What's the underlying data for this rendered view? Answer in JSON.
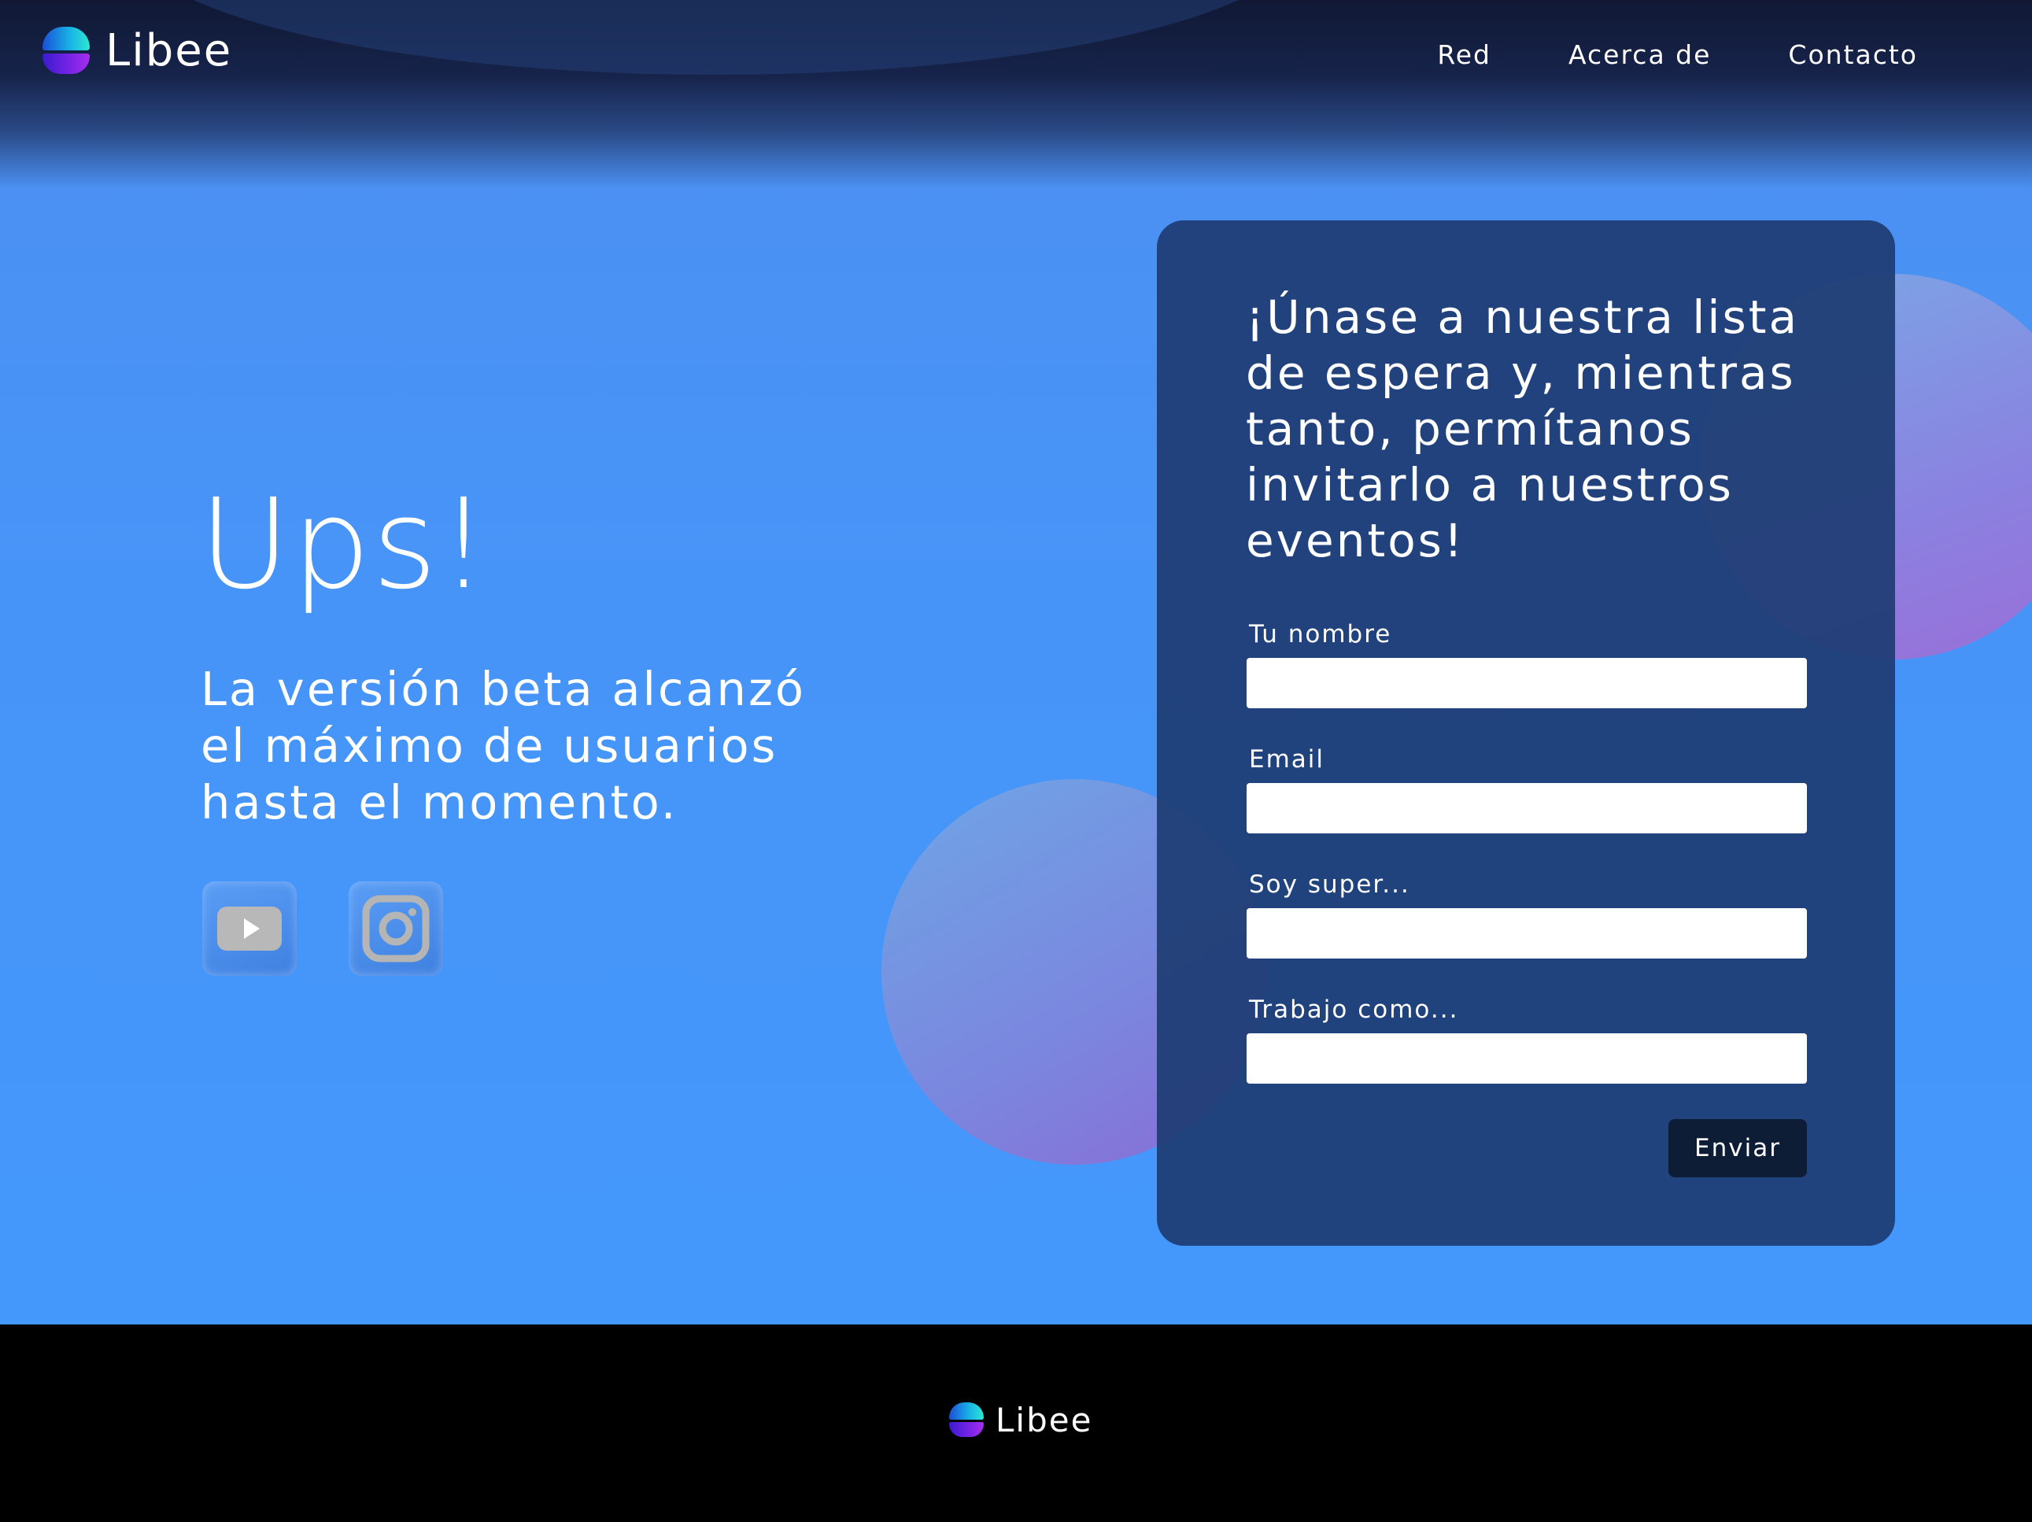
{
  "header": {
    "brand": "Libee",
    "nav": [
      {
        "label": "Red"
      },
      {
        "label": "Acerca de"
      },
      {
        "label": "Contacto"
      }
    ]
  },
  "hero": {
    "title": "Ups!",
    "subtitle": "La versión beta alcanzó el máximo de usuarios hasta el momento.",
    "socials": [
      {
        "icon": "youtube-icon"
      },
      {
        "icon": "instagram-icon"
      }
    ]
  },
  "form": {
    "title": "¡Únase a nuestra lista de espera y, mientras tanto, permítanos invitarlo a nuestros eventos!",
    "fields": [
      {
        "label": "Tu nombre",
        "value": ""
      },
      {
        "label": "Email",
        "value": ""
      },
      {
        "label": "Soy super...",
        "value": ""
      },
      {
        "label": "Trabajo como...",
        "value": ""
      }
    ],
    "submit_label": "Enviar"
  },
  "footer": {
    "brand": "Libee"
  },
  "colors": {
    "hero_blue": "#4695fa",
    "header_dark": "#101834",
    "card": "#1e3c73",
    "button": "#0e1d36",
    "footer": "#000000"
  }
}
